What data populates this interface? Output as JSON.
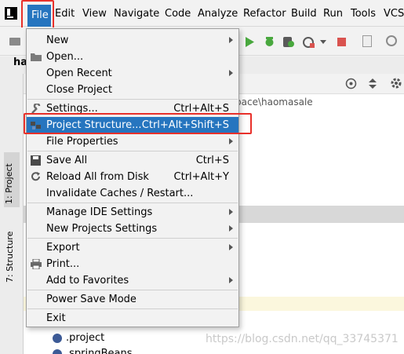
{
  "menubar": {
    "items": [
      "File",
      "Edit",
      "View",
      "Navigate",
      "Code",
      "Analyze",
      "Refactor",
      "Build",
      "Run",
      "Tools",
      "VCS"
    ]
  },
  "project_tab_label": "hao",
  "side_tabs": {
    "project": "1: Project",
    "structure": "7: Structure"
  },
  "path_text": "pace\\haomasale",
  "tree": {
    "project_file": ".project",
    "spring_file": ".springBeans"
  },
  "watermark": "https://blog.csdn.net/qq_33745371",
  "file_menu": {
    "new": "New",
    "open": "Open...",
    "open_recent": "Open Recent",
    "close_project": "Close Project",
    "settings": "Settings...",
    "settings_shortcut": "Ctrl+Alt+S",
    "project_structure": "Project Structure...",
    "project_structure_shortcut": "Ctrl+Alt+Shift+S",
    "file_properties": "File Properties",
    "save_all": "Save All",
    "save_all_shortcut": "Ctrl+S",
    "reload_all": "Reload All from Disk",
    "reload_all_shortcut": "Ctrl+Alt+Y",
    "invalidate_caches": "Invalidate Caches / Restart...",
    "manage_ide_settings": "Manage IDE Settings",
    "new_projects_settings": "New Projects Settings",
    "export": "Export",
    "print": "Print...",
    "add_to_favorites": "Add to Favorites",
    "power_save_mode": "Power Save Mode",
    "exit": "Exit"
  },
  "colors": {
    "selection": "#2675bf",
    "highlight_box": "#e8302a",
    "run_green": "#49a83e",
    "stop_red": "#d9534f"
  }
}
